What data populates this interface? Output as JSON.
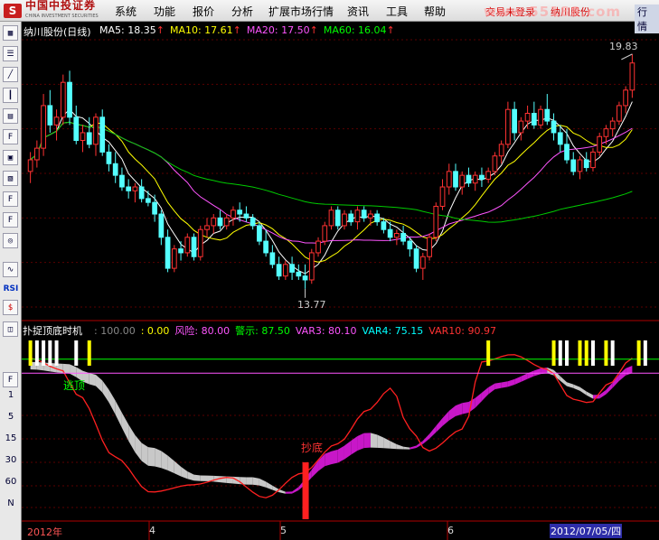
{
  "menu": {
    "logo_text": "中国中投证券",
    "logo_sub": "CHINA INVESTMENT SECURITIES",
    "items": [
      "系统",
      "功能",
      "报价",
      "分析",
      "扩展市场行情",
      "资讯",
      "工具",
      "帮助"
    ],
    "login_status": "交易未登录",
    "stock_name": "纳川股份",
    "right_label": "行情",
    "watermark": "www.55188.com"
  },
  "toolbar": {
    "buttons": [
      "chart-icon",
      "list-icon",
      "line-icon",
      "candle-icon",
      "table-icon",
      "F10",
      "doc-icon",
      "F2",
      "F10",
      "search-icon",
      "curve-icon",
      "RSI",
      "dollar-icon",
      "F5"
    ],
    "period_labels": [
      "1",
      "5",
      "15",
      "30",
      "60",
      "N"
    ]
  },
  "main_chart": {
    "title": "纳川股份(日线)",
    "ma": [
      {
        "label": "MA5:",
        "value": "18.35",
        "color": "#ffffff"
      },
      {
        "label": "MA10:",
        "value": "17.61",
        "color": "#ffff00"
      },
      {
        "label": "MA20:",
        "value": "17.50",
        "color": "#ff55ff"
      },
      {
        "label": "MA60:",
        "value": "16.04",
        "color": "#00ff00"
      }
    ],
    "high_label": "19.83",
    "low_label": "13.77"
  },
  "indicator": {
    "title": "扑捉顶底时机",
    "params": [
      {
        "label": "",
        "value": "100.00",
        "color": "#888888"
      },
      {
        "label": "",
        "value": "0.00",
        "color": "#ffff00"
      },
      {
        "label": "风险:",
        "value": "80.00",
        "color": "#ff55ff"
      },
      {
        "label": "警示:",
        "value": "87.50",
        "color": "#00ff00"
      },
      {
        "label": "VAR3:",
        "value": "80.10",
        "color": "#ff55ff"
      },
      {
        "label": "VAR4:",
        "value": "75.15",
        "color": "#00ffff"
      },
      {
        "label": "VAR10:",
        "value": "90.97",
        "color": "#ff3333"
      }
    ],
    "escape_label": "逃顶",
    "bottom_label": "抄底"
  },
  "time_axis": {
    "labels": [
      "2012年",
      "4",
      "5",
      "6"
    ],
    "cursor_date": "2012/07/05/四"
  },
  "chart_data": {
    "type": "candlestick",
    "candles": [
      [
        16.8,
        17.3,
        16.5,
        17.1
      ],
      [
        17.1,
        17.6,
        16.9,
        17.4
      ],
      [
        17.4,
        18.8,
        17.2,
        18.5
      ],
      [
        18.5,
        18.9,
        17.8,
        18.0
      ],
      [
        18.0,
        18.4,
        17.6,
        18.2
      ],
      [
        18.2,
        19.3,
        18.0,
        19.1
      ],
      [
        19.1,
        19.4,
        18.0,
        18.2
      ],
      [
        18.2,
        18.5,
        17.5,
        17.6
      ],
      [
        17.6,
        18.0,
        17.3,
        17.8
      ],
      [
        17.8,
        18.2,
        17.4,
        17.5
      ],
      [
        17.5,
        18.3,
        17.2,
        18.2
      ],
      [
        18.2,
        18.4,
        17.2,
        17.3
      ],
      [
        17.3,
        17.5,
        16.8,
        17.0
      ],
      [
        17.0,
        17.3,
        16.5,
        16.7
      ],
      [
        16.7,
        16.9,
        16.3,
        16.4
      ],
      [
        16.4,
        16.6,
        16.1,
        16.3
      ],
      [
        16.3,
        16.5,
        16.0,
        16.4
      ],
      [
        16.4,
        16.6,
        16.0,
        16.1
      ],
      [
        16.1,
        16.3,
        15.9,
        16.0
      ],
      [
        16.0,
        16.2,
        15.5,
        15.7
      ],
      [
        15.7,
        15.8,
        14.9,
        15.1
      ],
      [
        15.1,
        15.3,
        14.2,
        14.3
      ],
      [
        14.3,
        14.9,
        14.2,
        14.8
      ],
      [
        14.8,
        15.0,
        14.5,
        14.7
      ],
      [
        14.7,
        15.2,
        14.6,
        15.1
      ],
      [
        15.1,
        15.2,
        14.5,
        14.6
      ],
      [
        14.6,
        15.4,
        14.5,
        15.3
      ],
      [
        15.3,
        15.6,
        15.1,
        15.4
      ],
      [
        15.4,
        15.7,
        15.2,
        15.6
      ],
      [
        15.6,
        15.8,
        15.3,
        15.4
      ],
      [
        15.4,
        15.7,
        15.3,
        15.6
      ],
      [
        15.6,
        15.9,
        15.4,
        15.8
      ],
      [
        15.8,
        16.0,
        15.5,
        15.7
      ],
      [
        15.7,
        15.9,
        15.5,
        15.6
      ],
      [
        15.6,
        15.7,
        15.3,
        15.4
      ],
      [
        15.4,
        15.5,
        14.9,
        15.0
      ],
      [
        15.0,
        15.3,
        14.6,
        14.7
      ],
      [
        14.7,
        14.9,
        14.3,
        14.4
      ],
      [
        14.4,
        14.6,
        14.0,
        14.1
      ],
      [
        14.1,
        14.5,
        14.0,
        14.4
      ],
      [
        14.4,
        14.6,
        14.0,
        14.2
      ],
      [
        14.2,
        14.4,
        14.0,
        14.1
      ],
      [
        14.1,
        14.4,
        13.77,
        14.0
      ],
      [
        14.0,
        14.8,
        13.9,
        14.7
      ],
      [
        14.7,
        15.1,
        14.6,
        15.0
      ],
      [
        15.0,
        15.5,
        14.9,
        15.4
      ],
      [
        15.4,
        15.9,
        15.3,
        15.8
      ],
      [
        15.8,
        15.9,
        15.3,
        15.4
      ],
      [
        15.4,
        15.8,
        15.3,
        15.7
      ],
      [
        15.7,
        15.8,
        15.4,
        15.5
      ],
      [
        15.5,
        15.9,
        15.3,
        15.8
      ],
      [
        15.8,
        15.9,
        15.5,
        15.6
      ],
      [
        15.6,
        15.8,
        15.4,
        15.7
      ],
      [
        15.7,
        15.8,
        15.4,
        15.5
      ],
      [
        15.5,
        15.6,
        15.2,
        15.3
      ],
      [
        15.3,
        15.5,
        15.0,
        15.1
      ],
      [
        15.1,
        15.3,
        14.9,
        15.2
      ],
      [
        15.2,
        15.4,
        14.9,
        15.0
      ],
      [
        15.0,
        15.1,
        14.6,
        14.8
      ],
      [
        14.8,
        14.9,
        14.2,
        14.3
      ],
      [
        14.3,
        14.7,
        14.0,
        14.6
      ],
      [
        14.6,
        15.2,
        14.5,
        15.1
      ],
      [
        15.1,
        16.0,
        15.0,
        15.9
      ],
      [
        15.9,
        16.6,
        15.8,
        16.4
      ],
      [
        16.4,
        17.0,
        16.2,
        16.8
      ],
      [
        16.8,
        17.0,
        16.3,
        16.4
      ],
      [
        16.4,
        16.8,
        16.2,
        16.7
      ],
      [
        16.7,
        16.9,
        16.4,
        16.5
      ],
      [
        16.5,
        16.8,
        16.3,
        16.7
      ],
      [
        16.7,
        16.9,
        16.4,
        16.6
      ],
      [
        16.6,
        16.9,
        16.5,
        16.8
      ],
      [
        16.8,
        17.3,
        16.7,
        17.2
      ],
      [
        17.2,
        17.6,
        17.0,
        17.5
      ],
      [
        17.5,
        18.6,
        17.4,
        18.4
      ],
      [
        18.4,
        18.6,
        17.6,
        17.8
      ],
      [
        17.8,
        18.2,
        17.6,
        18.1
      ],
      [
        18.1,
        18.5,
        17.9,
        18.3
      ],
      [
        18.3,
        18.6,
        17.9,
        18.0
      ],
      [
        18.0,
        18.5,
        17.9,
        18.4
      ],
      [
        18.4,
        18.8,
        18.0,
        18.1
      ],
      [
        18.1,
        18.3,
        17.6,
        17.8
      ],
      [
        17.8,
        18.0,
        17.3,
        17.5
      ],
      [
        17.5,
        17.9,
        17.0,
        17.1
      ],
      [
        17.1,
        17.3,
        16.7,
        16.8
      ],
      [
        16.8,
        17.2,
        16.6,
        17.1
      ],
      [
        17.1,
        17.3,
        16.8,
        16.9
      ],
      [
        16.9,
        17.4,
        16.8,
        17.3
      ],
      [
        17.3,
        17.8,
        17.2,
        17.7
      ],
      [
        17.7,
        18.0,
        17.5,
        17.9
      ],
      [
        17.9,
        18.2,
        17.7,
        18.1
      ],
      [
        18.1,
        18.6,
        18.0,
        18.5
      ],
      [
        18.5,
        19.0,
        18.3,
        18.9
      ],
      [
        18.9,
        19.83,
        18.7,
        19.6
      ]
    ],
    "price_range": [
      13.3,
      20.2
    ],
    "indicator_range": [
      0,
      100
    ]
  }
}
